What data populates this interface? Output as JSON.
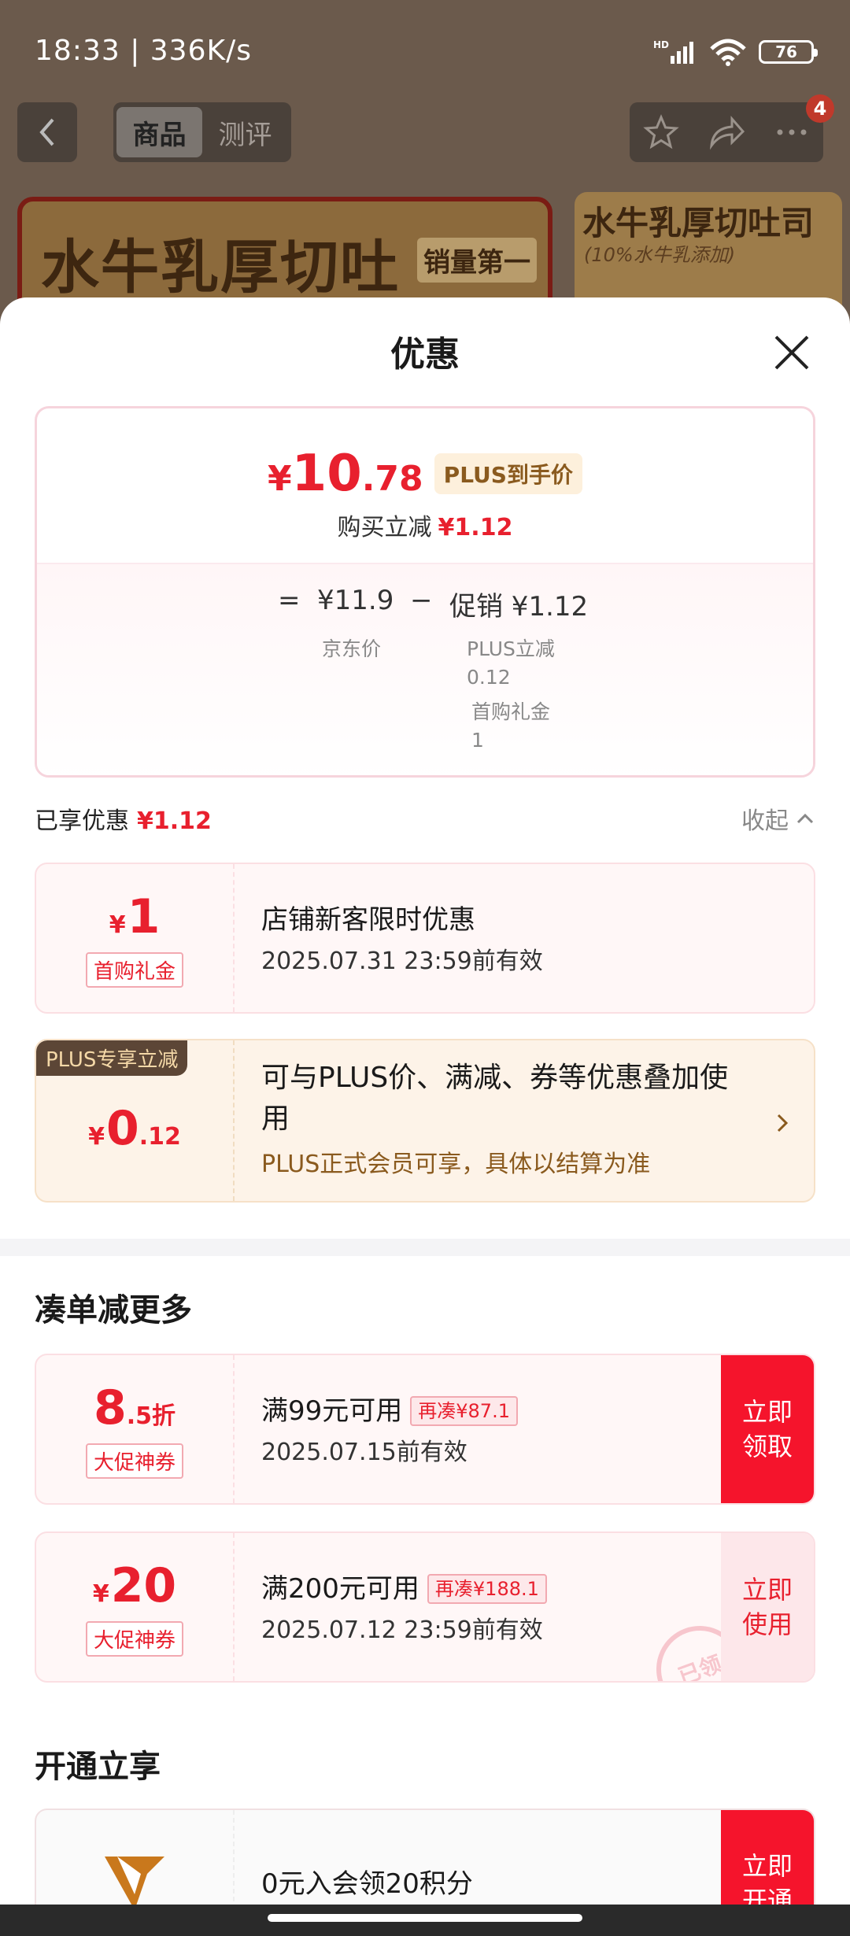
{
  "status_bar": {
    "time": "18:33 | 336K/s",
    "network": "HD",
    "battery": "76"
  },
  "nav": {
    "tabs": [
      {
        "label": "商品",
        "active": true
      },
      {
        "label": "测评",
        "active": false
      }
    ],
    "badge_count": "4"
  },
  "background_banner": {
    "left_title": "水牛乳厚切吐",
    "left_badge": "销量第一",
    "right_title": "水牛乳厚切吐司",
    "right_sub": "(10%水牛乳添加)"
  },
  "sheet": {
    "title": "优惠",
    "price": {
      "symbol": "¥",
      "integer": "10",
      "decimal": ".78",
      "tag": "PLUS到手价",
      "reduce_label": "购买立减",
      "reduce_value": "¥1.12"
    },
    "formula": {
      "eq": "=",
      "base_price": "¥11.9",
      "minus": "−",
      "promo": "促销 ¥1.12",
      "base_label": "京东价",
      "items": [
        {
          "label": "PLUS立减",
          "value": "0.12"
        },
        {
          "label": "首购礼金",
          "value": "1"
        }
      ]
    },
    "enjoyed": {
      "label": "已享优惠",
      "value": "¥1.12",
      "collapse": "收起"
    },
    "coupon_first": {
      "symbol": "¥",
      "amount": "1",
      "tag": "首购礼金",
      "title": "店铺新客限时优惠",
      "validity": "2025.07.31 23:59前有效"
    },
    "coupon_plus": {
      "corner": "PLUS专享立减",
      "symbol": "¥",
      "amount_int": "0",
      "amount_dec": ".12",
      "title": "可与PLUS价、满减、券等优惠叠加使用",
      "sub": "PLUS正式会员可享，具体以结算为准"
    },
    "section_more": "凑单减更多",
    "coupons_more": [
      {
        "amount_int": "8",
        "amount_suffix": ".5折",
        "tag": "大促神券",
        "title": "满99元可用",
        "extra": "再凑¥87.1",
        "validity": "2025.07.15前有效",
        "button": "立即领取"
      },
      {
        "symbol": "¥",
        "amount_int": "20",
        "tag": "大促神券",
        "title": "满200元可用",
        "extra": "再凑¥188.1",
        "validity": "2025.07.12 23:59前有效",
        "button": "立即使用",
        "stamp": "已领"
      }
    ],
    "section_open": "开通立享",
    "member": {
      "title": "0元入会领20积分",
      "button": "立即开通"
    }
  },
  "colors": {
    "accent": "#e8202e",
    "button_red": "#f5142c",
    "plus_brown": "#8a5a1e"
  }
}
